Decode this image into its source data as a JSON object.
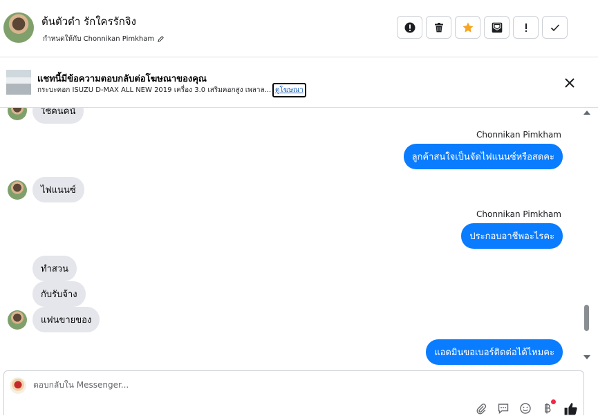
{
  "header": {
    "contact_name": "ต้นตัวดำ รักใครรักจิง",
    "assigned_to": "กำหนดให้กับ Chonnikan Pimkham",
    "actions": [
      {
        "icon": "alert-circle-icon",
        "name": "mark-spam-button"
      },
      {
        "icon": "trash-icon",
        "name": "delete-button"
      },
      {
        "icon": "star-icon",
        "name": "star-button"
      },
      {
        "icon": "mail-unread-icon",
        "name": "mark-unread-button"
      },
      {
        "icon": "exclamation-icon",
        "name": "follow-up-button"
      },
      {
        "icon": "check-icon",
        "name": "mark-done-button"
      }
    ],
    "star_color": "#f5a623"
  },
  "ad": {
    "title": "แชทนี้มีข้อความตอบกลับต่อโฆษณาของคุณ",
    "description": "กระบะคอก ISUZU D-MAX ALL NEW 2019 เครื่อง 3.0 เสริมคอกสูง เพลาล...",
    "link_label": "ดูโฆษณา"
  },
  "messages": {
    "m1": "ใช้คนคนั",
    "sender1": "Chonnikan Pimkham",
    "m2": "ลูกค้าสนใจเป็นจัดไฟแนนซ์หรือสดคะ",
    "m3": "ไฟแนนซ์",
    "sender2": "Chonnikan Pimkham",
    "m4": "ประกอบอาชีพอะไรคะ",
    "m5": "ทำสวน",
    "m6": "กับรับจ้าง",
    "m7": "แฟนขายของ",
    "m8": "แอดมินขอเบอร์ติดต่อได้ไหมคะ"
  },
  "composer": {
    "placeholder": "ตอบกลับใน Messenger...",
    "tools": [
      "attachment-icon",
      "saved-reply-icon",
      "emoji-icon",
      "payment-icon",
      "like-icon"
    ]
  },
  "colors": {
    "outgoing_bubble": "#0a7cff",
    "incoming_bubble": "#e4e6eb",
    "notification_dot": "#f02849"
  }
}
